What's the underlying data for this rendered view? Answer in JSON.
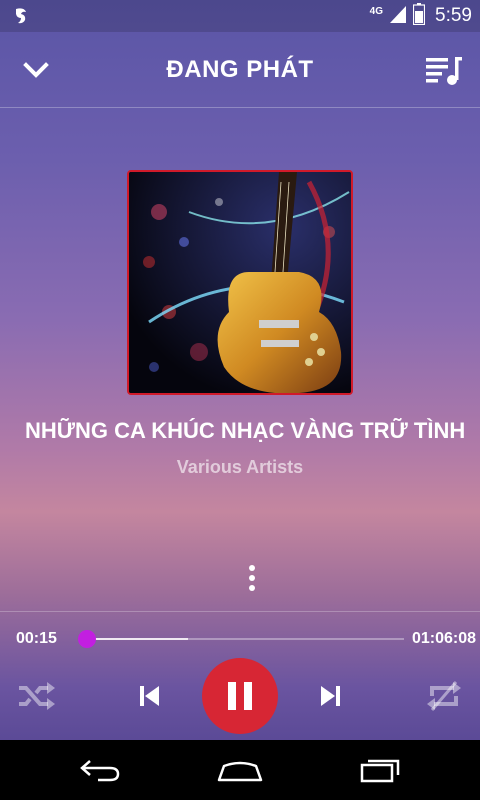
{
  "status_bar": {
    "network_type": "4G",
    "time": "5:59",
    "icons": [
      "notification-app-icon",
      "signal-icon",
      "battery-icon"
    ]
  },
  "header": {
    "title": "ĐANG PHÁT",
    "back_icon": "chevron-down-icon",
    "queue_icon": "playlist-icon"
  },
  "track": {
    "title": "NHỮNG CA KHÚC NHẠC VÀNG TRỮ TÌNH",
    "artist": "Various Artists",
    "album_art": "guitar-album-art"
  },
  "player": {
    "current_time": "00:15",
    "total_time": "01:06:08",
    "progress_fraction": 0.004,
    "buffered_fraction": 0.32,
    "accent_color": "#c21fe0",
    "play_button_color": "#d72634",
    "state": "playing",
    "controls": [
      "shuffle-icon",
      "previous-icon",
      "pause-icon",
      "next-icon",
      "repeat-icon"
    ]
  },
  "nav_bar": {
    "icons": [
      "back-icon",
      "home-icon",
      "recents-icon"
    ]
  }
}
